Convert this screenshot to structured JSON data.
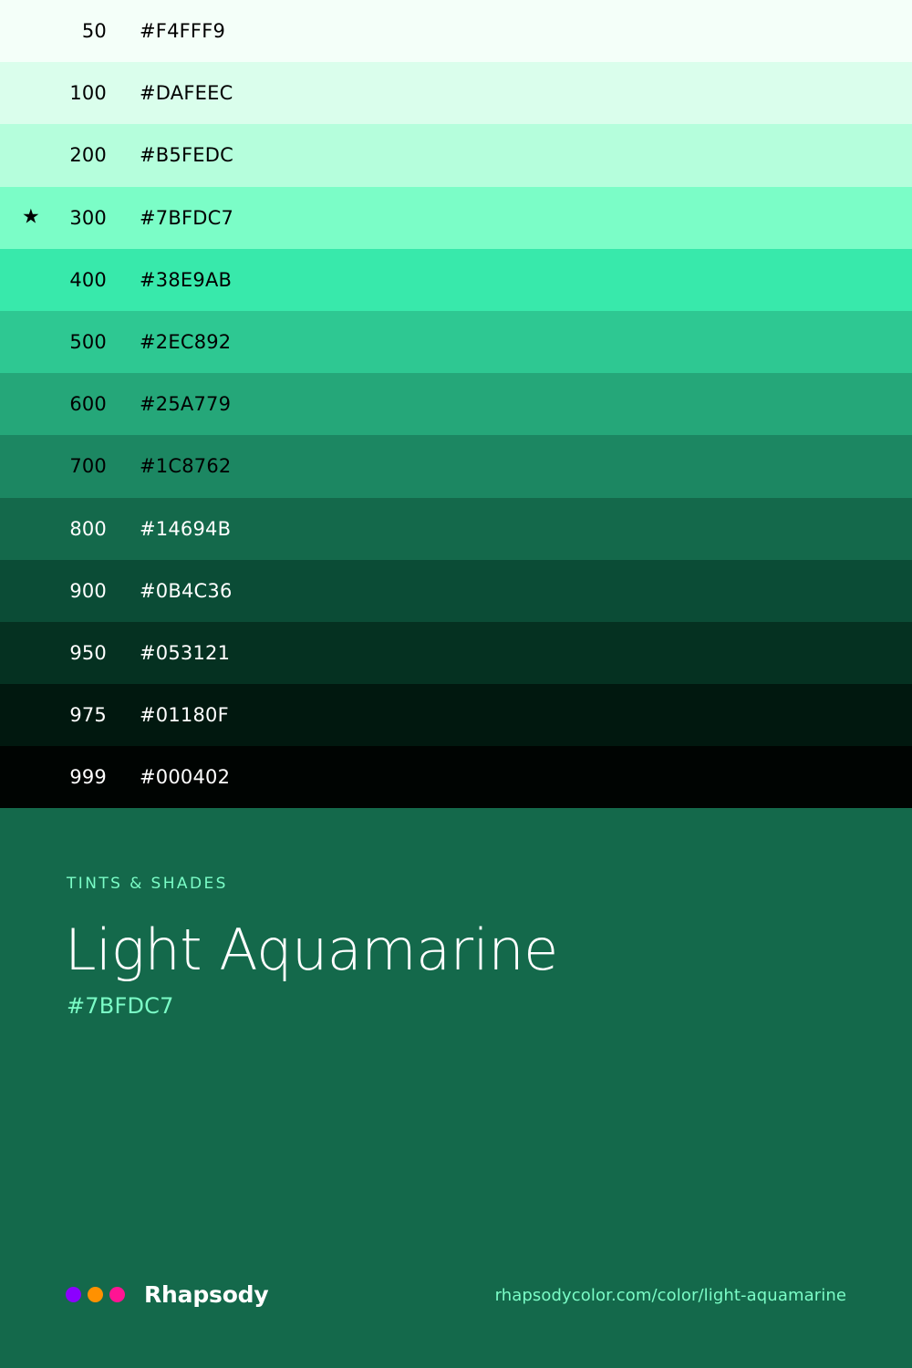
{
  "swatches": [
    {
      "step": "50",
      "hex": "#F4FFF9",
      "bg": "#F4FFF9",
      "text_color": "#000000",
      "starred": false
    },
    {
      "step": "100",
      "hex": "#DAFEEC",
      "bg": "#DAFEEC",
      "text_color": "#000000",
      "starred": false
    },
    {
      "step": "200",
      "hex": "#B5FEDC",
      "bg": "#B5FEDC",
      "text_color": "#000000",
      "starred": false
    },
    {
      "step": "300",
      "hex": "#7BFDC7",
      "bg": "#7BFDC7",
      "text_color": "#000000",
      "starred": true
    },
    {
      "step": "400",
      "hex": "#38E9AB",
      "bg": "#38E9AB",
      "text_color": "#000000",
      "starred": false
    },
    {
      "step": "500",
      "hex": "#2EC892",
      "bg": "#2EC892",
      "text_color": "#000000",
      "starred": false
    },
    {
      "step": "600",
      "hex": "#25A779",
      "bg": "#25A779",
      "text_color": "#000000",
      "starred": false
    },
    {
      "step": "700",
      "hex": "#1C8762",
      "bg": "#1C8762",
      "text_color": "#000000",
      "starred": false
    },
    {
      "step": "800",
      "hex": "#14694B",
      "bg": "#14694B",
      "text_color": "#FFFFFF",
      "starred": false
    },
    {
      "step": "900",
      "hex": "#0B4C36",
      "bg": "#0B4C36",
      "text_color": "#FFFFFF",
      "starred": false
    },
    {
      "step": "950",
      "hex": "#053121",
      "bg": "#053121",
      "text_color": "#FFFFFF",
      "starred": false
    },
    {
      "step": "975",
      "hex": "#01180F",
      "bg": "#01180F",
      "text_color": "#FFFFFF",
      "starred": false
    },
    {
      "step": "999",
      "hex": "#000402",
      "bg": "#000402",
      "text_color": "#FFFFFF",
      "starred": false
    }
  ],
  "star_glyph": "★",
  "info": {
    "eyebrow": "TINTS & SHADES",
    "title": "Light Aquamarine",
    "hex": "#7BFDC7",
    "background": "#14694B",
    "accent": "#7BFDC7"
  },
  "footer": {
    "brand_name": "Rhapsody",
    "brand_dots": [
      "#8B00FF",
      "#FF9100",
      "#FF1493"
    ],
    "url": "rhapsodycolor.com/color/light-aquamarine"
  }
}
